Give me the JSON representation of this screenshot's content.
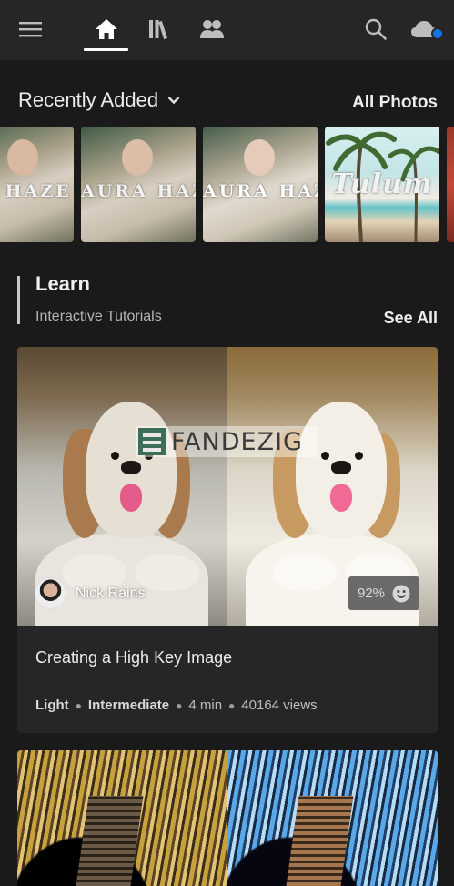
{
  "nav": {
    "menu_icon": "hamburger-menu-icon",
    "tabs": [
      {
        "name": "home",
        "icon": "home-icon",
        "active": true
      },
      {
        "name": "library",
        "icon": "library-icon",
        "active": false
      },
      {
        "name": "community",
        "icon": "people-icon",
        "active": false
      }
    ],
    "search_icon": "search-icon",
    "cloud_icon": "cloud-status-icon",
    "cloud_status_color": "#1473e6"
  },
  "recent": {
    "title": "Recently Added",
    "all_photos": "All Photos",
    "thumbs": [
      {
        "text": "A HAZE"
      },
      {
        "text": "AURA HAZE"
      },
      {
        "text": "AURA HAZE"
      },
      {
        "text": "Tulum"
      },
      {
        "text": ""
      }
    ]
  },
  "learn": {
    "title": "Learn",
    "subtitle": "Interactive Tutorials",
    "see_all": "See All"
  },
  "tutorial": {
    "watermark": "FANDEZIG",
    "author": "Nick Rains",
    "score": "92%",
    "title": "Creating a High Key Image",
    "meta": {
      "category": "Light",
      "level": "Intermediate",
      "duration": "4 min",
      "views": "40164 views"
    }
  },
  "colors": {
    "background": "#1a1a1a",
    "topbar": "#262626",
    "card": "#262626",
    "accent_blue": "#1473e6"
  }
}
